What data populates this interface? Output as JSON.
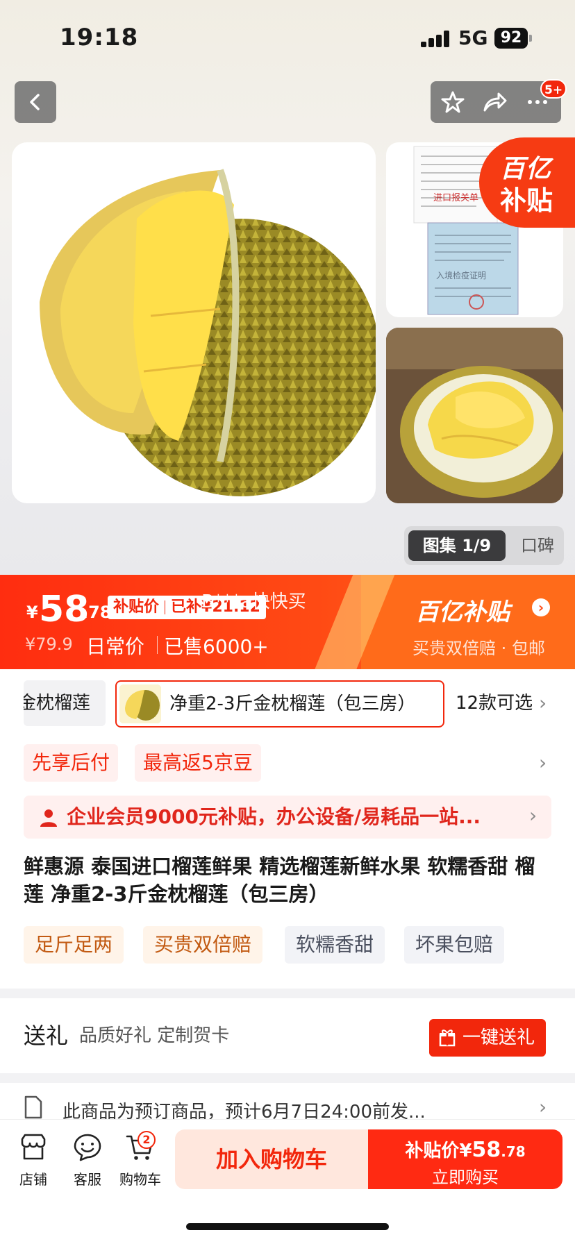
{
  "status_bar": {
    "time": "19:18",
    "network": "5G",
    "battery": "92"
  },
  "header": {
    "cart_badge": "5+"
  },
  "gallery": {
    "subsidy_tag_line1": "百亿",
    "subsidy_tag_line2": "补贴",
    "album_label": "图集 1/9",
    "reviews_label": "口碑",
    "doc_title": "进口报关单",
    "doc_stamp": "入境检疫证明"
  },
  "price": {
    "currency": "¥",
    "integer": "58",
    "decimal": ".78",
    "chip_label": "补贴价",
    "chip_saving": "已补¥21.12",
    "original": "¥79.9",
    "daily_label": "日常价",
    "sold": "已售6000+",
    "overlay_buyer": "B***a快快买",
    "brand_title": "百亿补贴",
    "brand_sub": "买贵双倍赔 · 包邮"
  },
  "variants": {
    "prev_label": "金枕榴莲",
    "selected_label": "净重2-3斤金枕榴莲（包三房）",
    "count_label": "12款可选"
  },
  "promos": [
    "先享后付",
    "最高返5京豆"
  ],
  "vip_banner": "企业会员9000元补贴，办公设备/易耗品一站...",
  "product_title": "鲜惠源 泰国进口榴莲鲜果 精选榴莲新鲜水果 软糯香甜 榴莲 净重2-3斤金枕榴莲（包三房）",
  "tags": [
    "足斤足两",
    "买贵双倍赔",
    "软糯香甜",
    "坏果包赔"
  ],
  "gift": {
    "title": "送礼",
    "subtitle": "品质好礼 定制贺卡",
    "button": "一键送礼"
  },
  "shipping_notice": "此商品为预订商品，预计6月7日24:00前发...",
  "bottom_bar": {
    "tabs": [
      "店铺",
      "客服",
      "购物车"
    ],
    "cart_count": "2",
    "add_to_cart": "加入购物车",
    "buy_price_label": "补贴价¥",
    "buy_price_int": "58",
    "buy_price_dec": ".78",
    "buy_now": "立即购买"
  },
  "colors": {
    "accent": "#f2270c",
    "band_start": "#ff2d10",
    "band_end": "#ff6a1f"
  }
}
